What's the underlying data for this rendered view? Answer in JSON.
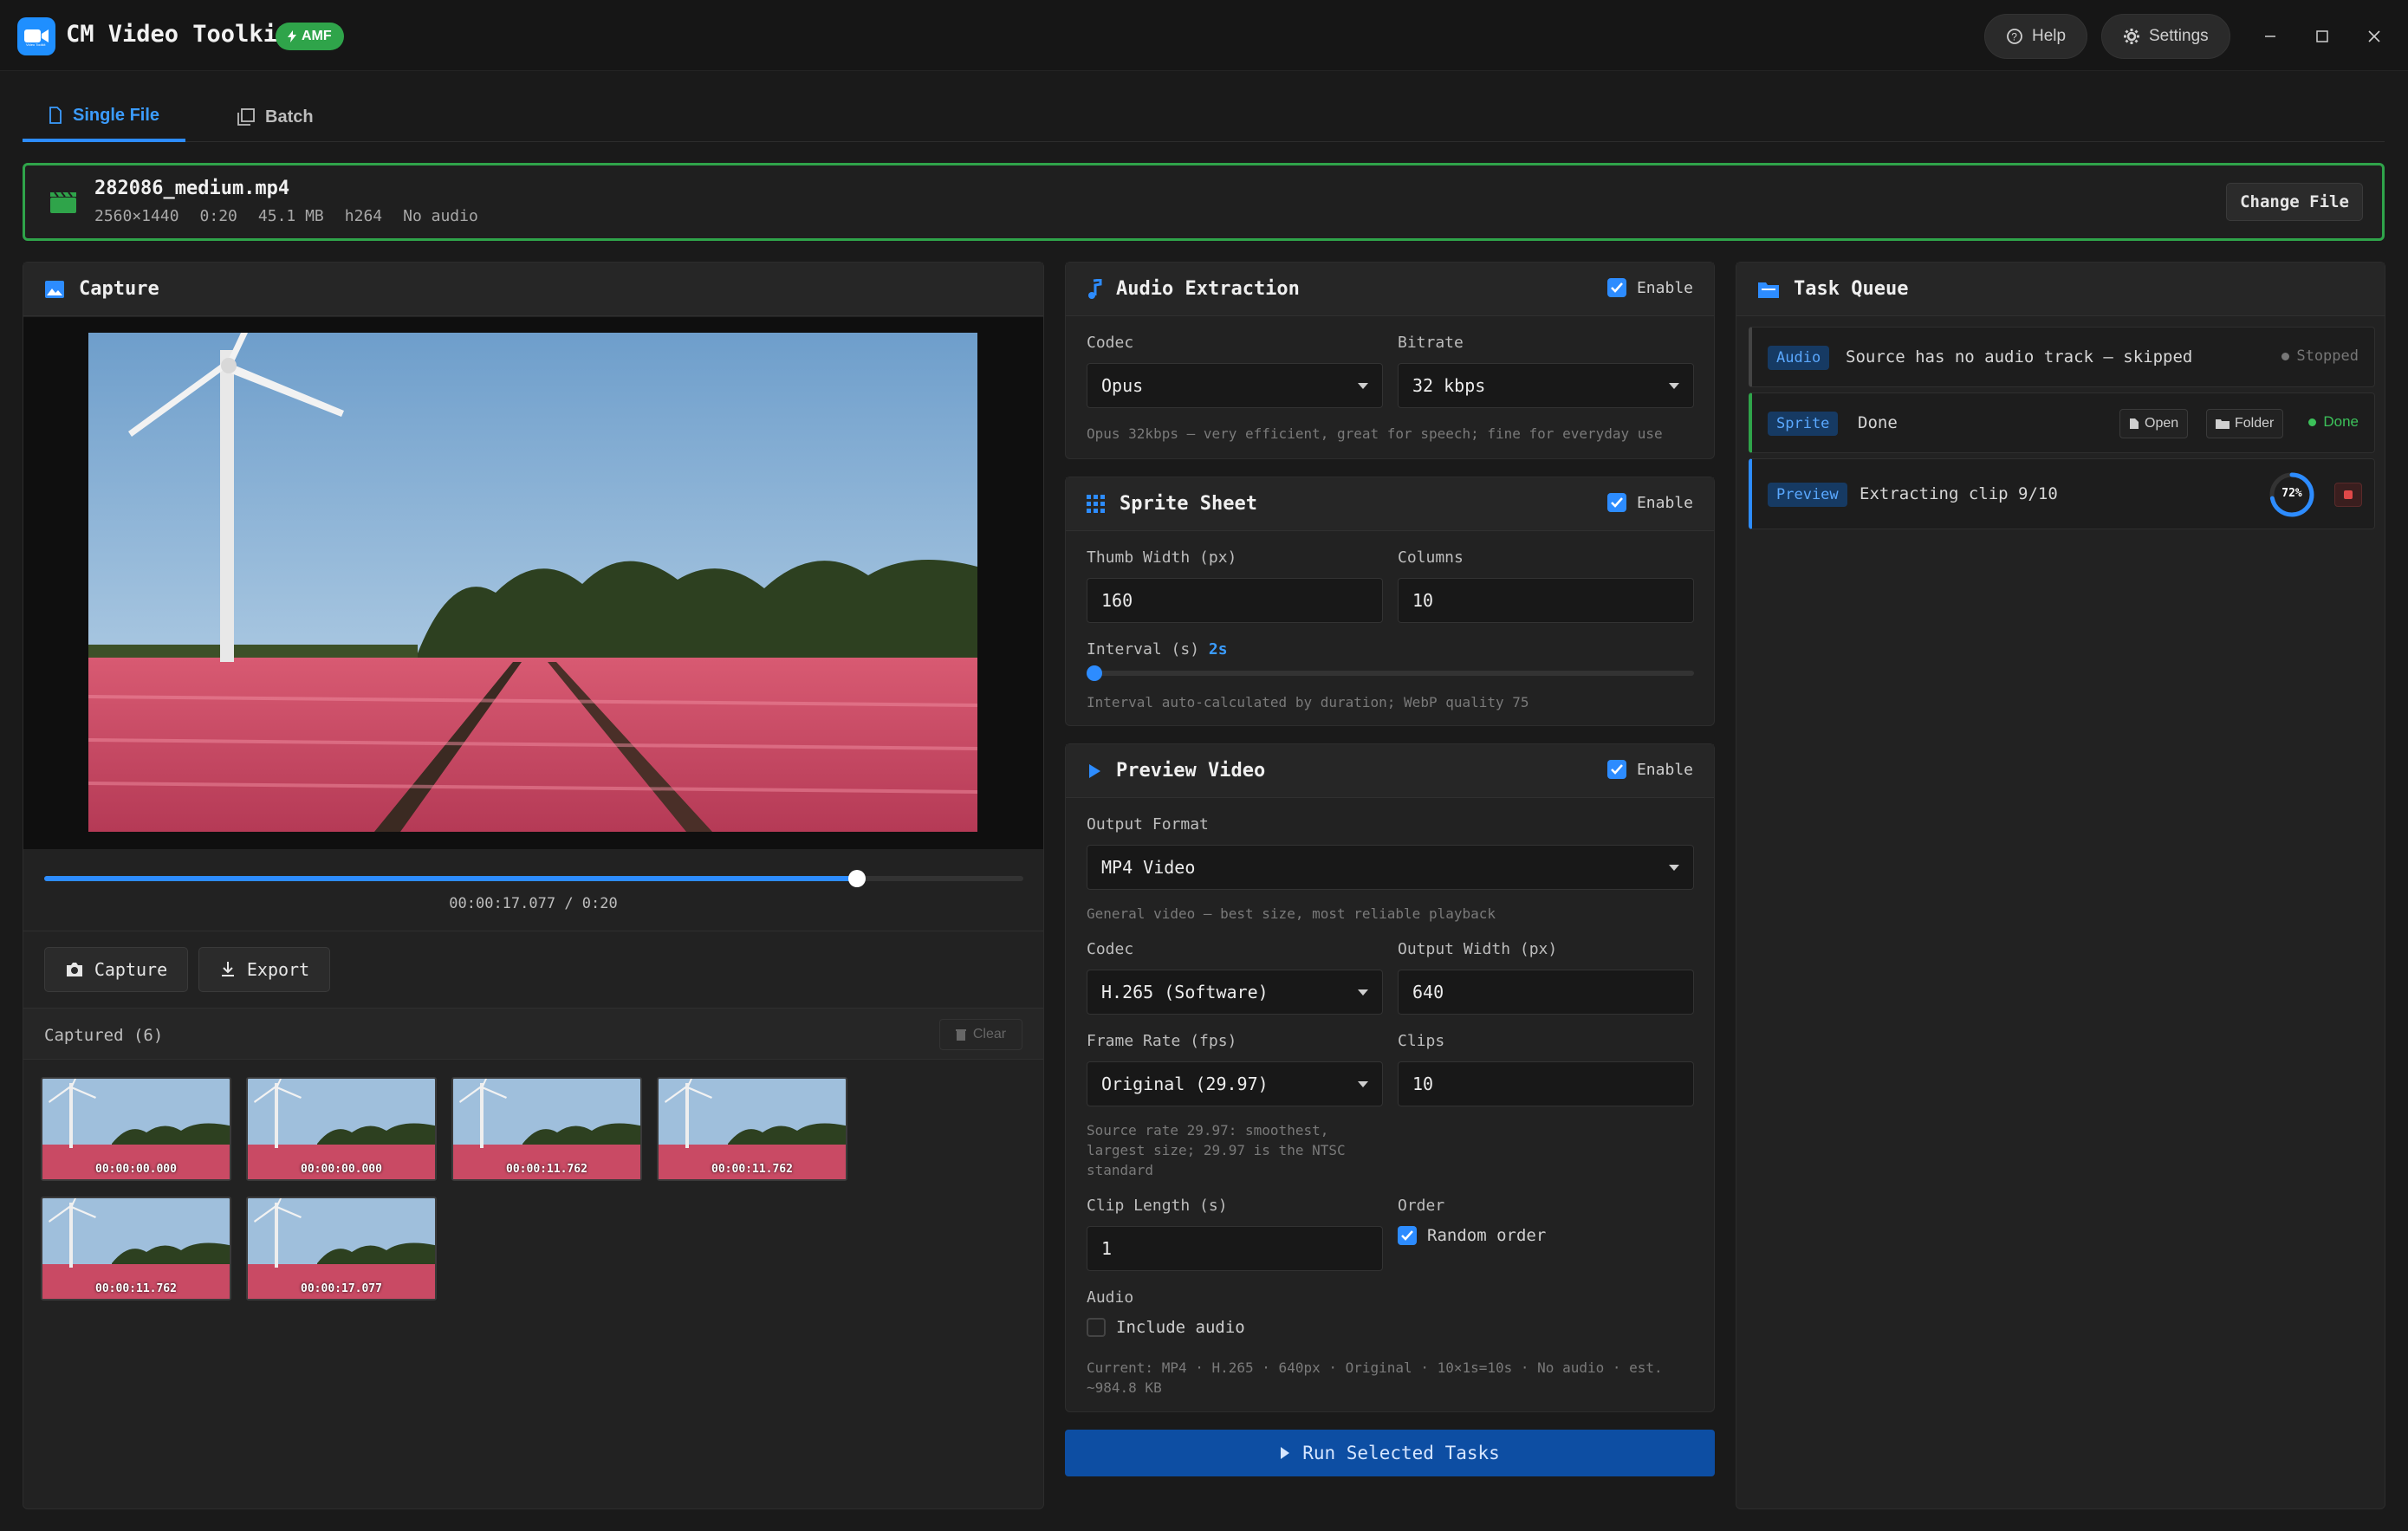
{
  "app": {
    "title": "CM Video Toolkit",
    "badge": "AMF",
    "logo_subtext": "Video Toolkit"
  },
  "titlebar": {
    "help_label": "Help",
    "settings_label": "Settings"
  },
  "tabs": [
    {
      "label": "Single File"
    },
    {
      "label": "Batch"
    }
  ],
  "file": {
    "name": "282086_medium.mp4",
    "resolution": "2560×1440",
    "duration": "0:20",
    "size": "45.1 MB",
    "codec": "h264",
    "audio": "No audio",
    "change_label": "Change File"
  },
  "capture": {
    "title": "Capture",
    "timecode": "00:00:17.077 / 0:20",
    "progress": 0.83,
    "capture_label": "Capture",
    "export_label": "Export",
    "captured_label": "Captured (6)",
    "clear_label": "Clear",
    "thumbnails": [
      {
        "time": "00:00:00.000"
      },
      {
        "time": "00:00:00.000"
      },
      {
        "time": "00:00:11.762"
      },
      {
        "time": "00:00:11.762"
      },
      {
        "time": "00:00:11.762"
      },
      {
        "time": "00:00:17.077"
      }
    ]
  },
  "audio_extraction": {
    "title": "Audio Extraction",
    "enable_label": "Enable",
    "codec_label": "Codec",
    "codec_value": "Opus",
    "bitrate_label": "Bitrate",
    "bitrate_value": "32 kbps",
    "hint": "Opus 32kbps — very efficient, great for speech; fine for everyday use"
  },
  "sprite_sheet": {
    "title": "Sprite Sheet",
    "enable_label": "Enable",
    "thumb_width_label": "Thumb Width (px)",
    "thumb_width_value": "160",
    "columns_label": "Columns",
    "columns_value": "10",
    "interval_label": "Interval (s)",
    "interval_value": "2s",
    "interval_slider": 0,
    "hint": "Interval auto-calculated by duration; WebP quality 75"
  },
  "preview_video": {
    "title": "Preview Video",
    "enable_label": "Enable",
    "output_format_label": "Output Format",
    "output_format_value": "MP4 Video",
    "output_format_hint": "General video — best size, most reliable playback",
    "codec_label": "Codec",
    "codec_value": "H.265 (Software)",
    "output_width_label": "Output Width (px)",
    "output_width_value": "640",
    "frame_rate_label": "Frame Rate (fps)",
    "frame_rate_value": "Original (29.97)",
    "clips_label": "Clips",
    "clips_value": "10",
    "frame_rate_hint": [
      "Source rate 29.97: smoothest,",
      "largest size; 29.97 is the NTSC",
      "standard"
    ],
    "clip_length_label": "Clip Length (s)",
    "clip_length_value": "1",
    "order_label": "Order",
    "random_order_label": "Random order",
    "audio_label": "Audio",
    "include_audio_label": "Include audio",
    "summary": [
      "Current: MP4 · H.265 · 640px · Original · 10×1s=10s · No audio · est.",
      "~984.8 KB"
    ]
  },
  "run_label": "Run Selected Tasks",
  "task_queue": {
    "title": "Task Queue",
    "tasks": [
      {
        "tag": "Audio",
        "text": "Source has no audio track — skipped",
        "status": "Stopped"
      },
      {
        "tag": "Sprite",
        "text": "Done",
        "open_label": "Open",
        "folder_label": "Folder",
        "status": "Done"
      },
      {
        "tag": "Preview",
        "text": "Extracting clip 9/10",
        "progress_label": "72%",
        "progress": 0.72
      }
    ]
  },
  "colors": {
    "accent": "#2d8cff",
    "success": "#2fa44a",
    "danger": "#c0392b",
    "run_button": "#0d4ea3"
  }
}
